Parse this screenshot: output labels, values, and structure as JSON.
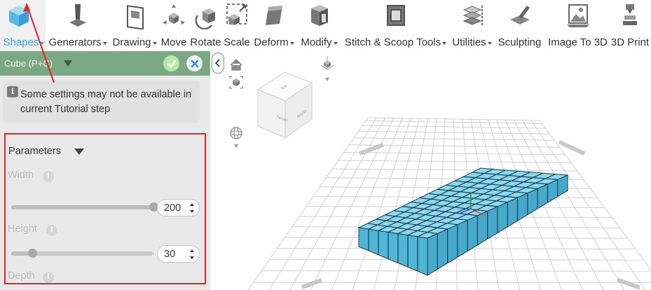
{
  "toolbar": {
    "items": [
      {
        "label": "D Shapes",
        "dropdown": true,
        "active": true,
        "icon": "cube-shapes-icon"
      },
      {
        "label": "Generators",
        "dropdown": true,
        "icon": "generators-icon"
      },
      {
        "label": "Drawing",
        "dropdown": true,
        "icon": "drawing-icon"
      },
      {
        "label": "Move",
        "dropdown": false,
        "icon": "move-icon"
      },
      {
        "label": "Rotate",
        "dropdown": false,
        "icon": "rotate-icon"
      },
      {
        "label": "Scale",
        "dropdown": false,
        "icon": "scale-icon"
      },
      {
        "label": "Deform",
        "dropdown": true,
        "icon": "deform-icon"
      },
      {
        "label": "Modify",
        "dropdown": true,
        "icon": "modify-icon"
      },
      {
        "label": "Stitch & Scoop Tools",
        "dropdown": true,
        "icon": "stitch-scoop-icon"
      },
      {
        "label": "Utilities",
        "dropdown": true,
        "icon": "utilities-icon"
      },
      {
        "label": "Sculpting",
        "dropdown": false,
        "icon": "sculpting-icon"
      },
      {
        "label": "Image To 3D",
        "dropdown": false,
        "icon": "image-to-3d-icon"
      },
      {
        "label": "3D Print",
        "dropdown": false,
        "icon": "3d-print-icon"
      }
    ]
  },
  "panel": {
    "title": "Cube (P+C)",
    "notice": "Some settings may not be available in current Tutorial step",
    "params_title": "Parameters",
    "width": {
      "label": "Width",
      "value": "200",
      "fraction": 1.0
    },
    "height": {
      "label": "Height",
      "value": "30",
      "fraction": 0.15
    },
    "depth": {
      "label": "Depth"
    }
  },
  "viewcube": {
    "front": "FRONT",
    "right": "RIGHT",
    "top": "TOP"
  },
  "colors": {
    "accent": "#3aa0d8",
    "panel_header": "#7ca884",
    "highlight_border": "#e8202a",
    "model": "#5bc8e8"
  }
}
